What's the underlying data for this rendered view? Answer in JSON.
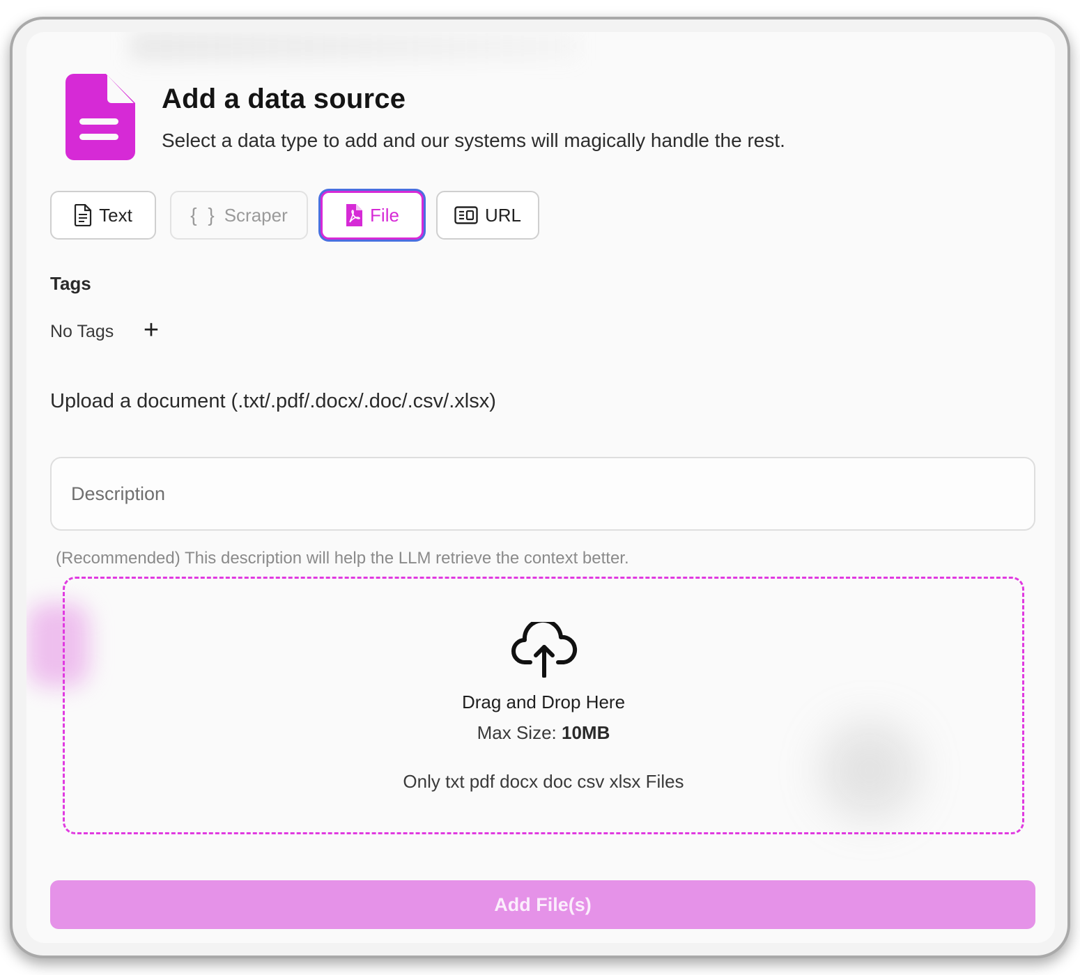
{
  "header": {
    "icon": "document-icon",
    "title": "Add a data source",
    "subtitle": "Select a data type to add and our systems will magically handle the rest."
  },
  "tabs": [
    {
      "label": "Text",
      "icon": "document-icon",
      "state": "normal"
    },
    {
      "label": "Scraper",
      "icon": "braces-icon",
      "state": "disabled"
    },
    {
      "label": "File",
      "icon": "pdf-file-icon",
      "state": "selected"
    },
    {
      "label": "URL",
      "icon": "link-box-icon",
      "state": "normal"
    }
  ],
  "tags": {
    "label": "Tags",
    "empty_text": "No Tags",
    "add_glyph": "+"
  },
  "upload": {
    "label": "Upload a document (.txt/.pdf/.docx/.doc/.csv/.xlsx)"
  },
  "description": {
    "placeholder": "Description",
    "value": "",
    "help": "(Recommended) This description will help the LLM retrieve the context better."
  },
  "dropzone": {
    "icon": "cloud-upload-icon",
    "title": "Drag and Drop Here",
    "max_size_label": "Max Size: ",
    "max_size_value": "10MB",
    "types_text": "Only txt pdf docx doc csv xlsx Files"
  },
  "submit": {
    "label": "Add File(s)"
  },
  "colors": {
    "accent": "#d62ad6",
    "focus_ring": "#4a6fe0",
    "submit_bg": "#e592e8"
  }
}
